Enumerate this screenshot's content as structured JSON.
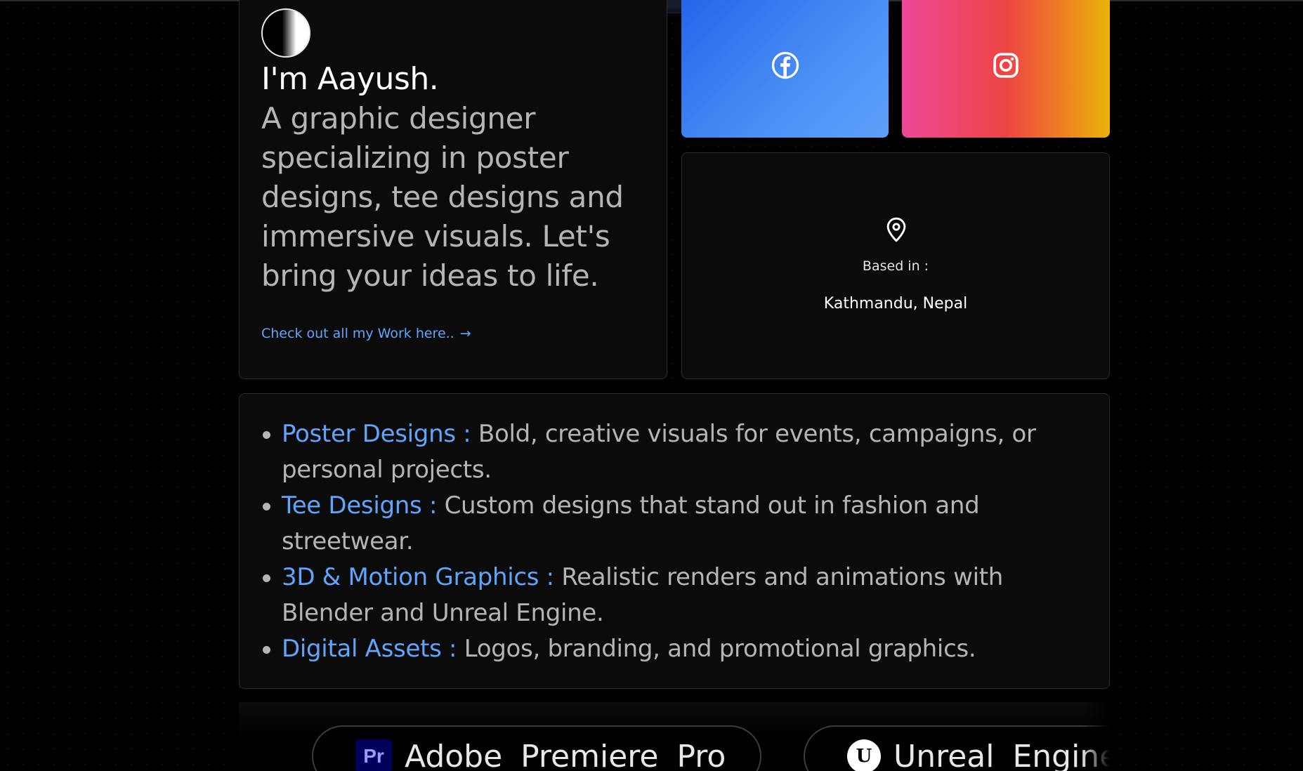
{
  "intro": {
    "title": "I'm Aayush.",
    "description": "A graphic designer specializing in poster designs, tee designs and immersive visuals. Let's bring your ideas to life.",
    "work_link": "Check out all my Work here..",
    "work_link_arrow": "→"
  },
  "social": {
    "facebook_icon": "facebook-icon",
    "instagram_icon": "instagram-icon"
  },
  "location": {
    "label": "Based in :",
    "city": "Kathmandu, Nepal"
  },
  "services": [
    {
      "name": "Poster Designs :",
      "text": " Bold, creative visuals for events, campaigns, or personal projects."
    },
    {
      "name": "Tee Designs :",
      "text": " Custom designs that stand out in fashion and streetwear."
    },
    {
      "name": "3D & Motion Graphics :",
      "text": " Realistic renders and animations with Blender and Unreal Engine."
    },
    {
      "name": "Digital Assets :",
      "text": " Logos, branding, and promotional graphics."
    }
  ],
  "tools": [
    {
      "label": "Adobe Premiere Pro",
      "logo_text": "Pr"
    },
    {
      "label": "Unreal Engine",
      "logo_text": "U"
    }
  ],
  "colors": {
    "accent": "#60a5fa",
    "background": "#000000",
    "card": "#0b0b0c",
    "facebook_gradient": [
      "#2563eb",
      "#5ea0fa"
    ],
    "instagram_gradient": [
      "#ec4899",
      "#ef4444",
      "#eab308"
    ]
  }
}
